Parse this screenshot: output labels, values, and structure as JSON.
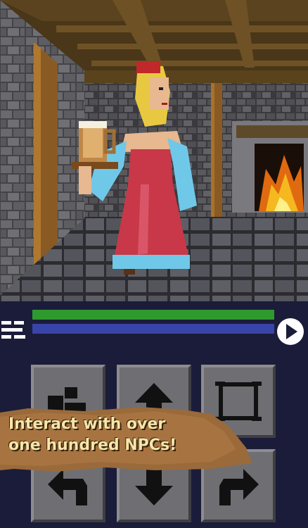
{
  "status": {
    "health_fraction": 1.0,
    "mana_fraction": 1.0,
    "health_color": "#2e9a2e",
    "mana_color": "#3844a8"
  },
  "controls": {
    "icons": [
      "map-icon",
      "up-arrow-icon",
      "frame-icon",
      "turn-left-icon",
      "down-arrow-icon",
      "turn-right-icon"
    ]
  },
  "banner": {
    "line1": "Interact with over",
    "line2": "one hundred NPCs!"
  }
}
